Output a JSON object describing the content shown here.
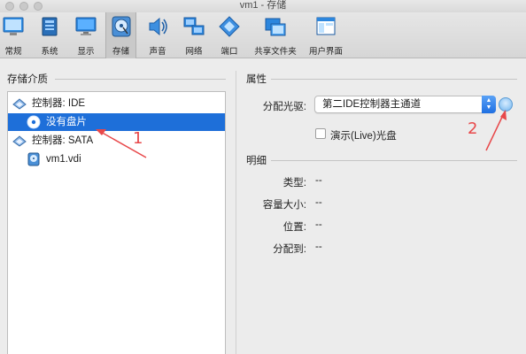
{
  "window": {
    "title": "vm1 - 存储"
  },
  "toolbar": {
    "items": [
      {
        "label": "常规",
        "icon": "general-icon"
      },
      {
        "label": "系统",
        "icon": "system-icon"
      },
      {
        "label": "显示",
        "icon": "display-icon"
      },
      {
        "label": "存储",
        "icon": "storage-icon",
        "active": true
      },
      {
        "label": "声音",
        "icon": "audio-icon"
      },
      {
        "label": "网络",
        "icon": "network-icon"
      },
      {
        "label": "端口",
        "icon": "ports-icon"
      },
      {
        "label": "共享文件夹",
        "icon": "shared-folder-icon"
      },
      {
        "label": "用户界面",
        "icon": "user-interface-icon"
      }
    ]
  },
  "storage": {
    "section_title": "存储介质",
    "tree": [
      {
        "label": "控制器: IDE",
        "type": "controller"
      },
      {
        "label": "没有盘片",
        "type": "optical",
        "selected": true
      },
      {
        "label": "控制器: SATA",
        "type": "controller"
      },
      {
        "label": "vm1.vdi",
        "type": "disk"
      }
    ]
  },
  "attributes": {
    "section_title": "属性",
    "optical_drive_label": "分配光驱:",
    "optical_drive_value": "第二IDE控制器主通道",
    "live_cd_label": "演示(Live)光盘",
    "live_cd_checked": false
  },
  "details": {
    "section_title": "明细",
    "rows": [
      {
        "label": "类型:",
        "value": "--"
      },
      {
        "label": "容量大小:",
        "value": "--"
      },
      {
        "label": "位置:",
        "value": "--"
      },
      {
        "label": "分配到:",
        "value": "--"
      }
    ]
  },
  "annotations": {
    "marker1": "1",
    "marker2": "2"
  },
  "colors": {
    "selection": "#1e6fd9",
    "annotation": "#e8484a",
    "accent": "#1f6fe2"
  }
}
